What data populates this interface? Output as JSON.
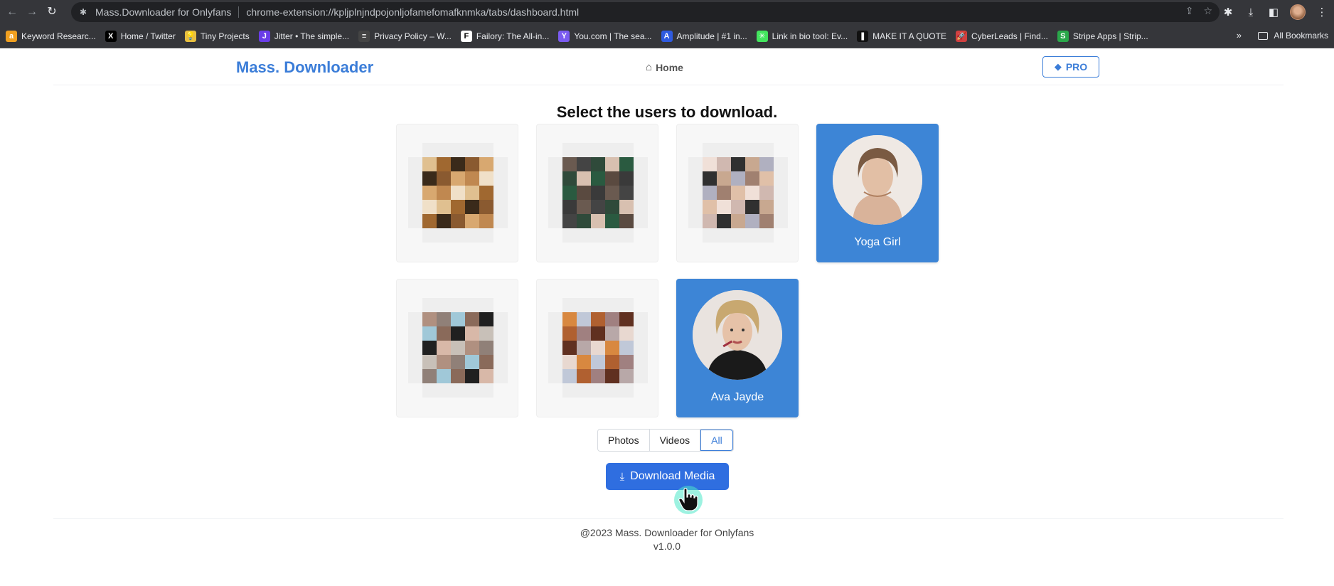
{
  "browser": {
    "site_name": "Mass.Downloader for Onlyfans",
    "url": "chrome-extension://kpljplnjndpojonljofamefomafknmka/tabs/dashboard.html",
    "bookmarks": [
      {
        "label": "Keyword Researc...",
        "icon": "amazon-icon",
        "color": "#f0a020",
        "glyph": "a"
      },
      {
        "label": "Home / Twitter",
        "icon": "x-icon",
        "color": "#000000",
        "glyph": "X"
      },
      {
        "label": "Tiny Projects",
        "icon": "lightbulb-icon",
        "color": "#e8c040",
        "glyph": "💡"
      },
      {
        "label": "Jitter • The simple...",
        "icon": "jitter-icon",
        "color": "#6a3de8",
        "glyph": "J"
      },
      {
        "label": "Privacy Policy – W...",
        "icon": "document-icon",
        "color": "#444444",
        "glyph": "≡"
      },
      {
        "label": "Failory: The All-in...",
        "icon": "failory-icon",
        "color": "#ffffff",
        "glyph": "F"
      },
      {
        "label": "You.com | The sea...",
        "icon": "you-icon",
        "color": "#7b5bf0",
        "glyph": "Y"
      },
      {
        "label": "Amplitude | #1 in...",
        "icon": "amplitude-icon",
        "color": "#2f5be0",
        "glyph": "A"
      },
      {
        "label": "Link in bio tool: Ev...",
        "icon": "linktree-icon",
        "color": "#43e55e",
        "glyph": "✳"
      },
      {
        "label": "MAKE IT A QUOTE",
        "icon": "quote-icon",
        "color": "#111111",
        "glyph": "❚"
      },
      {
        "label": "CyberLeads | Find...",
        "icon": "rocket-icon",
        "color": "#d04040",
        "glyph": "🚀"
      },
      {
        "label": "Stripe Apps | Strip...",
        "icon": "stripe-icon",
        "color": "#2aa84a",
        "glyph": "S"
      }
    ],
    "more_label": "»",
    "all_bookmarks_label": "All Bookmarks"
  },
  "header": {
    "brand": "Mass. Downloader",
    "home_label": "Home",
    "pro_label": "PRO"
  },
  "main": {
    "title": "Select the users to download.",
    "users": [
      {
        "name": "",
        "selected": false,
        "blurred": true
      },
      {
        "name": "",
        "selected": false,
        "blurred": true
      },
      {
        "name": "",
        "selected": false,
        "blurred": true
      },
      {
        "name": "Yoga Girl",
        "selected": true,
        "blurred": false
      },
      {
        "name": "",
        "selected": false,
        "blurred": true
      },
      {
        "name": "",
        "selected": false,
        "blurred": true
      },
      {
        "name": "Ava Jayde",
        "selected": true,
        "blurred": false
      }
    ],
    "filter_tabs": [
      {
        "label": "Photos",
        "active": false
      },
      {
        "label": "Videos",
        "active": false
      },
      {
        "label": "All",
        "active": true
      }
    ],
    "download_label": "Download Media"
  },
  "footer": {
    "copyright": "@2023 Mass. Downloader for Onlyfans",
    "version": "v1.0.0"
  },
  "colors": {
    "accent": "#3b7dd8",
    "selected_card": "#3d85d6",
    "download_button": "#2f6ee0",
    "chrome_bg": "#35363a"
  }
}
